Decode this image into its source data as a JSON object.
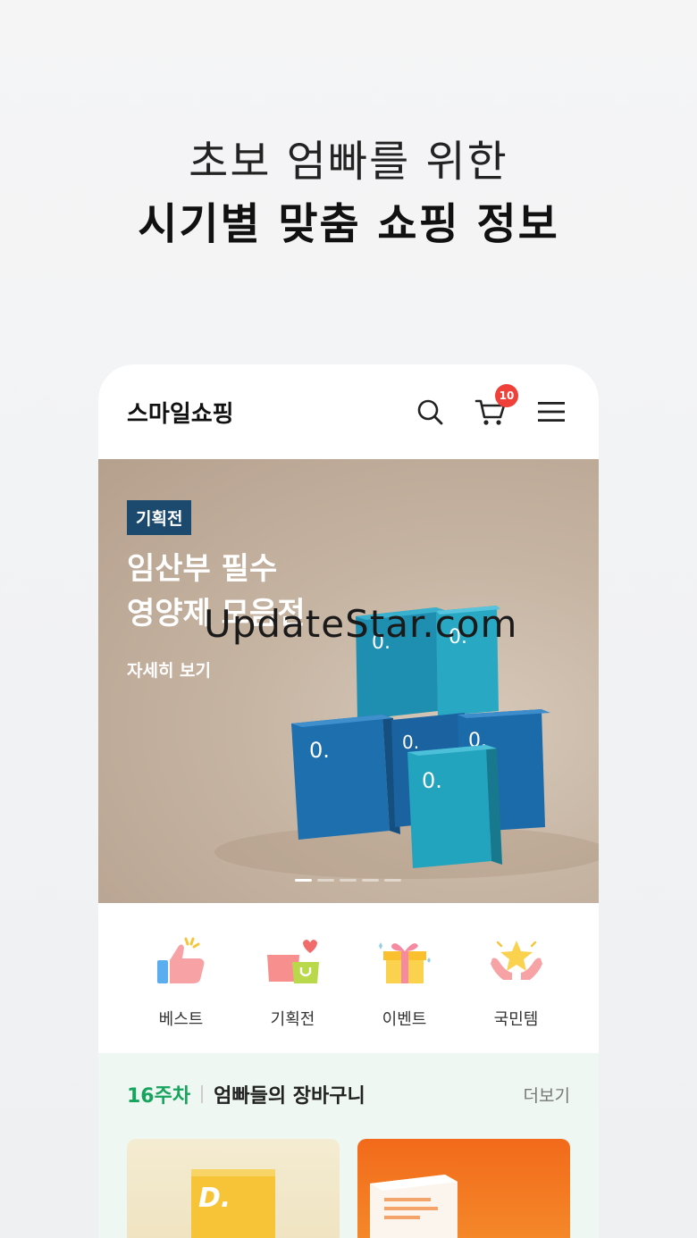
{
  "headline": {
    "line1": "초보 엄빠를 위한",
    "line2": "시기별 맞춤 쇼핑 정보"
  },
  "app": {
    "title": "스마일쇼핑",
    "cart_count": "10"
  },
  "banner": {
    "tag": "기획전",
    "title": "임산부 필수\n영양제 모음전",
    "link": "자세히 보기",
    "watermark": "UpdateStar.com",
    "slide_total": 5,
    "slide_active": 1
  },
  "categories": [
    {
      "label": "베스트",
      "icon": "thumbs-up-icon"
    },
    {
      "label": "기획전",
      "icon": "shopping-bags-icon"
    },
    {
      "label": "이벤트",
      "icon": "gift-icon"
    },
    {
      "label": "국민템",
      "icon": "star-hands-icon"
    }
  ],
  "weekly": {
    "week": "16주차",
    "title": "엄빠들의 장바구니",
    "more": "더보기"
  },
  "colors": {
    "accent_green": "#17a45e",
    "badge_red": "#f0403a",
    "tag_navy": "#1c4a6e"
  }
}
